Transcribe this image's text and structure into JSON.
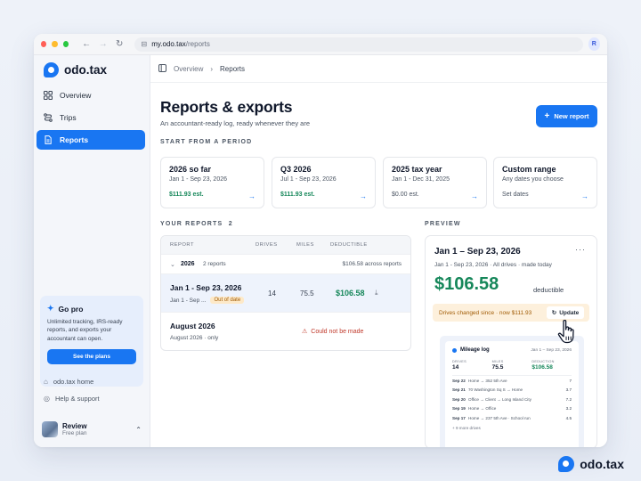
{
  "browser": {
    "url_host": "my.odo.tax",
    "url_path": "/reports",
    "avatar_initial": "R"
  },
  "brand": {
    "name": "odo.tax",
    "color": "#1976f2"
  },
  "sidebar": {
    "items": [
      {
        "label": "Overview",
        "icon": "grid-icon"
      },
      {
        "label": "Trips",
        "icon": "route-icon"
      },
      {
        "label": "Reports",
        "icon": "document-icon",
        "active": true
      }
    ],
    "gopro": {
      "title": "Go pro",
      "text": "Unlimited tracking, IRS-ready reports, and exports your accountant can open.",
      "button": "See the plans"
    },
    "links": [
      {
        "label": "odo.tax home",
        "icon": "home-icon"
      },
      {
        "label": "Help & support",
        "icon": "help-icon"
      }
    ],
    "profile": {
      "name": "Review",
      "plan": "Free plan"
    }
  },
  "breadcrumb": {
    "parent": "Overview",
    "current": "Reports"
  },
  "header": {
    "title": "Reports & exports",
    "subtitle": "An accountant-ready log, ready whenever they are",
    "new_button": "New report"
  },
  "periods": {
    "label": "START FROM A PERIOD",
    "cards": [
      {
        "title": "2026 so far",
        "range": "Jan 1 - Sep 23, 2026",
        "est": "$111.93 est.",
        "style": "green"
      },
      {
        "title": "Q3 2026",
        "range": "Jul 1 - Sep 23, 2026",
        "est": "$111.93 est.",
        "style": "green"
      },
      {
        "title": "2025 tax year",
        "range": "Jan 1 - Dec 31, 2025",
        "est": "$0.00 est.",
        "style": "gray"
      },
      {
        "title": "Custom range",
        "range": "Any dates you choose",
        "est": "Set dates",
        "style": "gray"
      }
    ]
  },
  "reports": {
    "label": "YOUR REPORTS",
    "count": "2",
    "columns": {
      "report": "REPORT",
      "drives": "DRIVES",
      "miles": "MILES",
      "deductible": "DEDUCTIBLE"
    },
    "group": {
      "year": "2026",
      "count_label": "2 reports",
      "total": "$106.58 across reports"
    },
    "rows": [
      {
        "title": "Jan 1 - Sep 23, 2026",
        "meta": "Jan 1 - Sep ...",
        "badge": "Out of date",
        "drives": "14",
        "miles": "75.5",
        "deductible": "$106.58"
      },
      {
        "title": "August 2026",
        "meta": "August 2026 · only",
        "error": "Could not be made"
      }
    ]
  },
  "preview": {
    "label": "PREVIEW",
    "title": "Jan 1 – Sep 23, 2026",
    "sub": "Jan 1 - Sep 23, 2026 · All drives · made today",
    "amount": "$106.58",
    "amount_label": "deductible",
    "warning": "Drives changed since · now $111.93",
    "update": "Update",
    "doc": {
      "title": "Mileage log",
      "date": "Jan 1 – Sep 23, 2026",
      "stats": [
        {
          "label": "DRIVES",
          "value": "14"
        },
        {
          "label": "MILES",
          "value": "75.5"
        },
        {
          "label": "DEDUCTION",
          "value": "$106.58"
        }
      ],
      "trips": [
        {
          "date": "Sep 22",
          "route": "Home → 352 5th Ave",
          "miles": "7"
        },
        {
          "date": "Sep 21",
          "route": "70 Washington Sq S → Home",
          "miles": "3.7"
        },
        {
          "date": "Sep 20",
          "route": "Office → Client → Long Island City",
          "miles": "7.2"
        },
        {
          "date": "Sep 19",
          "route": "Home → Office",
          "miles": "3.2"
        },
        {
          "date": "Sep 17",
          "route": "Home → 237 5th Ave · School run",
          "miles": "4.5"
        }
      ],
      "more": "+ 9 more drives"
    }
  }
}
